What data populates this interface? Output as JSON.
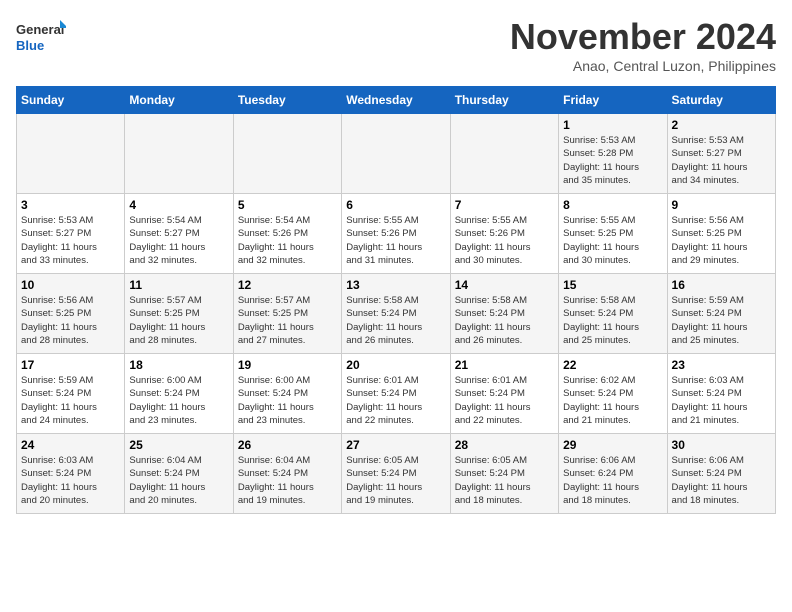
{
  "logo": {
    "line1": "General",
    "line2": "Blue"
  },
  "title": "November 2024",
  "subtitle": "Anao, Central Luzon, Philippines",
  "days_of_week": [
    "Sunday",
    "Monday",
    "Tuesday",
    "Wednesday",
    "Thursday",
    "Friday",
    "Saturday"
  ],
  "weeks": [
    [
      {
        "day": "",
        "info": ""
      },
      {
        "day": "",
        "info": ""
      },
      {
        "day": "",
        "info": ""
      },
      {
        "day": "",
        "info": ""
      },
      {
        "day": "",
        "info": ""
      },
      {
        "day": "1",
        "info": "Sunrise: 5:53 AM\nSunset: 5:28 PM\nDaylight: 11 hours\nand 35 minutes."
      },
      {
        "day": "2",
        "info": "Sunrise: 5:53 AM\nSunset: 5:27 PM\nDaylight: 11 hours\nand 34 minutes."
      }
    ],
    [
      {
        "day": "3",
        "info": "Sunrise: 5:53 AM\nSunset: 5:27 PM\nDaylight: 11 hours\nand 33 minutes."
      },
      {
        "day": "4",
        "info": "Sunrise: 5:54 AM\nSunset: 5:27 PM\nDaylight: 11 hours\nand 32 minutes."
      },
      {
        "day": "5",
        "info": "Sunrise: 5:54 AM\nSunset: 5:26 PM\nDaylight: 11 hours\nand 32 minutes."
      },
      {
        "day": "6",
        "info": "Sunrise: 5:55 AM\nSunset: 5:26 PM\nDaylight: 11 hours\nand 31 minutes."
      },
      {
        "day": "7",
        "info": "Sunrise: 5:55 AM\nSunset: 5:26 PM\nDaylight: 11 hours\nand 30 minutes."
      },
      {
        "day": "8",
        "info": "Sunrise: 5:55 AM\nSunset: 5:25 PM\nDaylight: 11 hours\nand 30 minutes."
      },
      {
        "day": "9",
        "info": "Sunrise: 5:56 AM\nSunset: 5:25 PM\nDaylight: 11 hours\nand 29 minutes."
      }
    ],
    [
      {
        "day": "10",
        "info": "Sunrise: 5:56 AM\nSunset: 5:25 PM\nDaylight: 11 hours\nand 28 minutes."
      },
      {
        "day": "11",
        "info": "Sunrise: 5:57 AM\nSunset: 5:25 PM\nDaylight: 11 hours\nand 28 minutes."
      },
      {
        "day": "12",
        "info": "Sunrise: 5:57 AM\nSunset: 5:25 PM\nDaylight: 11 hours\nand 27 minutes."
      },
      {
        "day": "13",
        "info": "Sunrise: 5:58 AM\nSunset: 5:24 PM\nDaylight: 11 hours\nand 26 minutes."
      },
      {
        "day": "14",
        "info": "Sunrise: 5:58 AM\nSunset: 5:24 PM\nDaylight: 11 hours\nand 26 minutes."
      },
      {
        "day": "15",
        "info": "Sunrise: 5:58 AM\nSunset: 5:24 PM\nDaylight: 11 hours\nand 25 minutes."
      },
      {
        "day": "16",
        "info": "Sunrise: 5:59 AM\nSunset: 5:24 PM\nDaylight: 11 hours\nand 25 minutes."
      }
    ],
    [
      {
        "day": "17",
        "info": "Sunrise: 5:59 AM\nSunset: 5:24 PM\nDaylight: 11 hours\nand 24 minutes."
      },
      {
        "day": "18",
        "info": "Sunrise: 6:00 AM\nSunset: 5:24 PM\nDaylight: 11 hours\nand 23 minutes."
      },
      {
        "day": "19",
        "info": "Sunrise: 6:00 AM\nSunset: 5:24 PM\nDaylight: 11 hours\nand 23 minutes."
      },
      {
        "day": "20",
        "info": "Sunrise: 6:01 AM\nSunset: 5:24 PM\nDaylight: 11 hours\nand 22 minutes."
      },
      {
        "day": "21",
        "info": "Sunrise: 6:01 AM\nSunset: 5:24 PM\nDaylight: 11 hours\nand 22 minutes."
      },
      {
        "day": "22",
        "info": "Sunrise: 6:02 AM\nSunset: 5:24 PM\nDaylight: 11 hours\nand 21 minutes."
      },
      {
        "day": "23",
        "info": "Sunrise: 6:03 AM\nSunset: 5:24 PM\nDaylight: 11 hours\nand 21 minutes."
      }
    ],
    [
      {
        "day": "24",
        "info": "Sunrise: 6:03 AM\nSunset: 5:24 PM\nDaylight: 11 hours\nand 20 minutes."
      },
      {
        "day": "25",
        "info": "Sunrise: 6:04 AM\nSunset: 5:24 PM\nDaylight: 11 hours\nand 20 minutes."
      },
      {
        "day": "26",
        "info": "Sunrise: 6:04 AM\nSunset: 5:24 PM\nDaylight: 11 hours\nand 19 minutes."
      },
      {
        "day": "27",
        "info": "Sunrise: 6:05 AM\nSunset: 5:24 PM\nDaylight: 11 hours\nand 19 minutes."
      },
      {
        "day": "28",
        "info": "Sunrise: 6:05 AM\nSunset: 5:24 PM\nDaylight: 11 hours\nand 18 minutes."
      },
      {
        "day": "29",
        "info": "Sunrise: 6:06 AM\nSunset: 6:24 PM\nDaylight: 11 hours\nand 18 minutes."
      },
      {
        "day": "30",
        "info": "Sunrise: 6:06 AM\nSunset: 5:24 PM\nDaylight: 11 hours\nand 18 minutes."
      }
    ]
  ]
}
